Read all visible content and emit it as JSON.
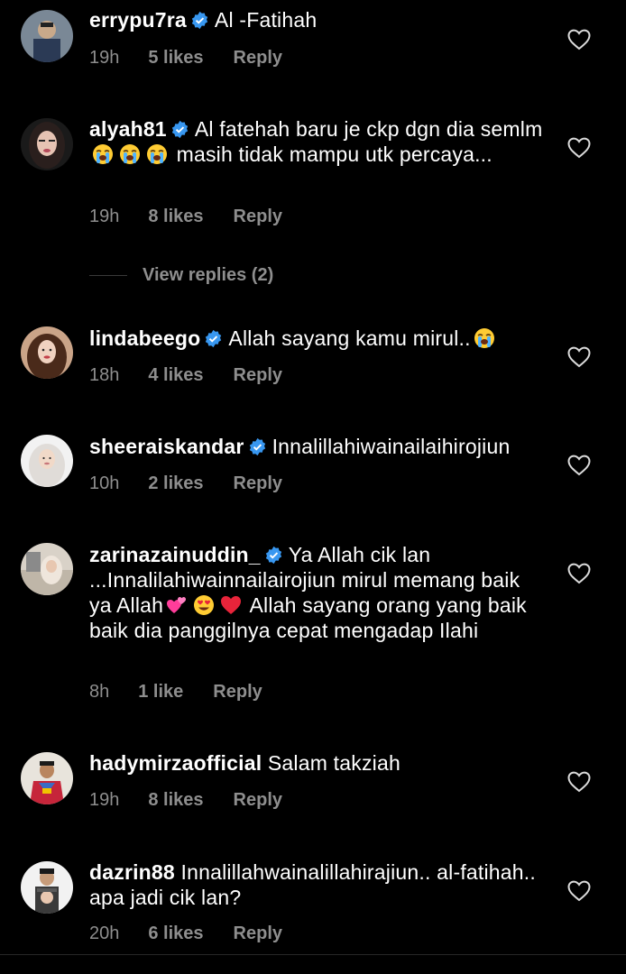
{
  "comments": [
    {
      "username": "errypu7ra",
      "text": "Al -Fatihah",
      "time": "19h",
      "likes": "5 likes",
      "reply": "Reply",
      "verified": true
    },
    {
      "username": "alyah81",
      "text_parts": [
        "Al fatehah baru je ckp dgn dia semlm",
        "masih tidak mampu utk percaya..."
      ],
      "emojis": [
        "loudly-crying-face",
        "loudly-crying-face",
        "loudly-crying-face"
      ],
      "time": "19h",
      "likes": "8 likes",
      "reply": "Reply",
      "verified": true
    },
    {
      "username": "lindabeego",
      "text": "Allah sayang kamu mirul..",
      "emojis": [
        "loudly-crying-face"
      ],
      "time": "18h",
      "likes": "4 likes",
      "reply": "Reply",
      "verified": true
    },
    {
      "username": "sheeraiskandar",
      "text": "Innalillahiwainailaihirojiun",
      "time": "10h",
      "likes": "2 likes",
      "reply": "Reply",
      "verified": true
    },
    {
      "username": "zarinazainuddin_",
      "text_parts": [
        "Ya Allah cik lan ...Innalilahiwainnailairojiun  mirul memang baik ya Allah",
        "Allah sayang orang yang baik baik dia panggilnya cepat mengadap Ilahi"
      ],
      "emojis": [
        "two-hearts",
        "smiling-face-with-heart-eyes",
        "red-heart"
      ],
      "time": "8h",
      "likes": "1 like",
      "reply": "Reply",
      "verified": true
    },
    {
      "username": "hadymirzaofficial",
      "text": "Salam takziah",
      "time": "19h",
      "likes": "8 likes",
      "reply": "Reply",
      "verified": false
    },
    {
      "username": "dazrin88",
      "text": "Innalillahwainalillahirajiun.. al-fatihah.. apa jadi cik lan?",
      "time": "20h",
      "likes": "6 likes",
      "reply": "Reply",
      "verified": false
    }
  ],
  "view_replies": "View replies (2)",
  "colors": {
    "background": "#000000",
    "text_primary": "#ffffff",
    "text_secondary": "#8e8e8e",
    "verified_badge": "#3897f0"
  }
}
